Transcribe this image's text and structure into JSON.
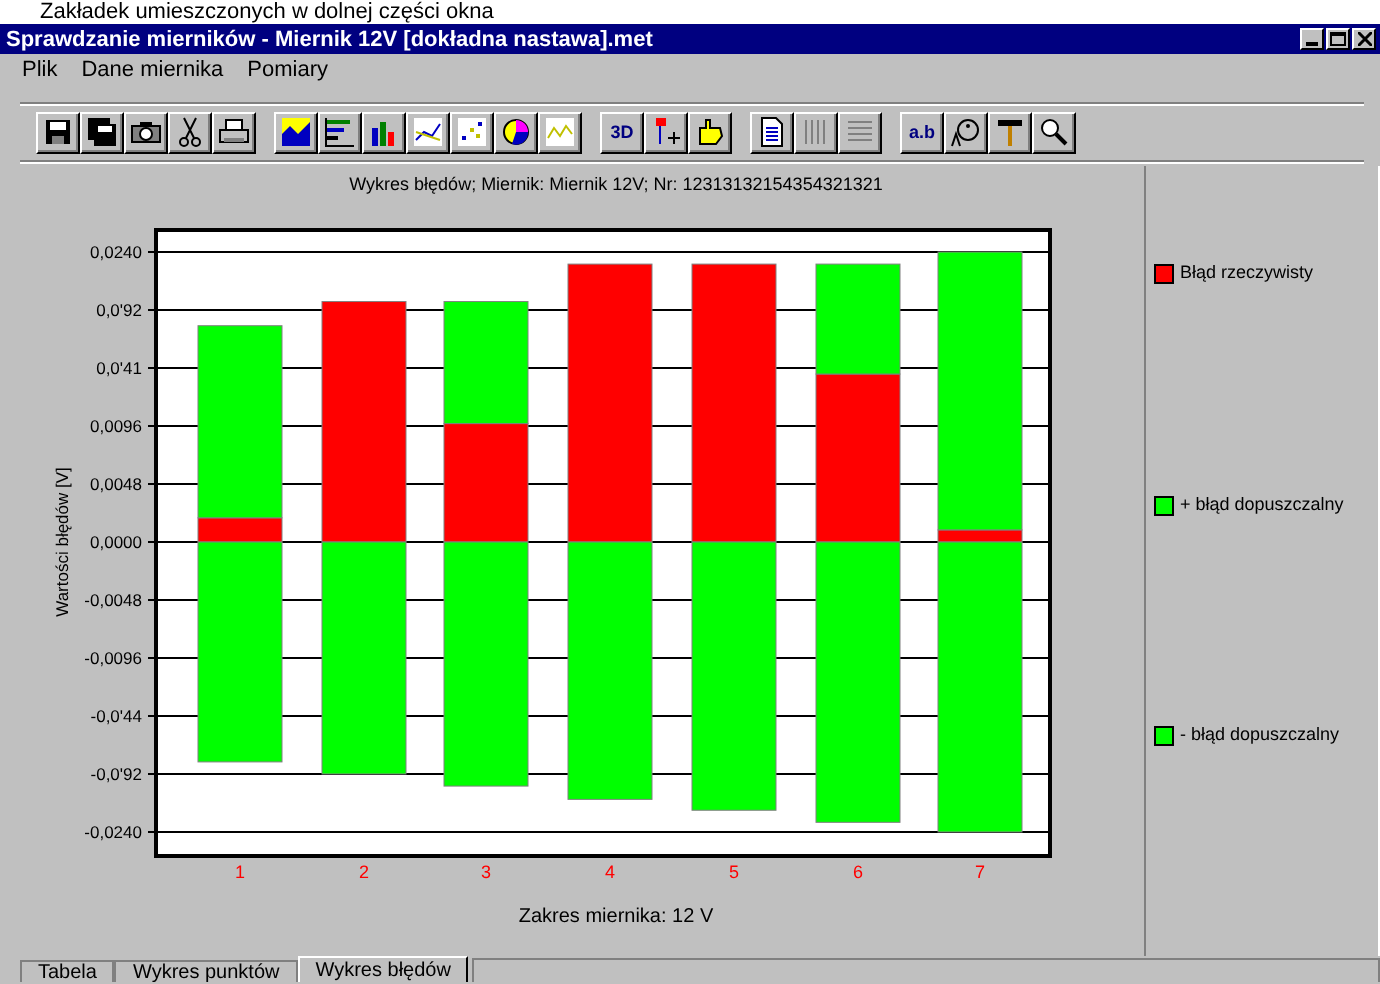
{
  "caption": "Zakładek umieszczonych w dolnej części okna",
  "window": {
    "title": "Sprawdzanie mierników - Miernik 12V [dokładna nastawa].met"
  },
  "menu": [
    "Plik",
    "Dane miernika",
    "Pomiary"
  ],
  "toolbar": [
    [
      {
        "kind": "floppy"
      },
      {
        "kind": "floppy-stack"
      },
      {
        "kind": "camera"
      },
      {
        "kind": "scissors"
      },
      {
        "kind": "printer"
      }
    ],
    [
      {
        "kind": "area"
      },
      {
        "kind": "hbar"
      },
      {
        "kind": "bar"
      },
      {
        "kind": "line"
      },
      {
        "kind": "scatter"
      },
      {
        "kind": "pie"
      },
      {
        "kind": "wave"
      }
    ],
    [
      {
        "kind": "text",
        "label": "3D"
      },
      {
        "kind": "pin"
      },
      {
        "kind": "hand"
      }
    ],
    [
      {
        "kind": "page"
      },
      {
        "kind": "columns"
      },
      {
        "kind": "rows"
      }
    ],
    [
      {
        "kind": "text",
        "label": "a.b"
      },
      {
        "kind": "font"
      },
      {
        "kind": "hammer"
      },
      {
        "kind": "zoom"
      }
    ]
  ],
  "chart": {
    "chart_data": {
      "type": "bar",
      "stacked": true,
      "title": "Wykres błędów; Miernik: Miernik 12V; Nr: 12313132154354321321",
      "xlabel": "Zakres miernika: 12 V",
      "ylabel": "Wartości błędów [V]",
      "categories": [
        "1",
        "2",
        "3",
        "4",
        "5",
        "6",
        "7"
      ],
      "series": [
        {
          "name": "Błąd rzeczywisty",
          "color": "#ff0000",
          "values": [
            0.002,
            0.0199,
            0.0098,
            0.023,
            0.023,
            0.0139,
            0.001
          ]
        },
        {
          "name": "+ błąd dopuszczalny",
          "color": "#00ff00",
          "values": [
            0.0159,
            0,
            0.0101,
            0,
            0,
            0.0091,
            0.023
          ]
        },
        {
          "name": "- błąd dopuszczalny",
          "color": "#00ff00",
          "values": [
            -0.0182,
            -0.0192,
            -0.0202,
            -0.0213,
            -0.0222,
            -0.0232,
            -0.024
          ]
        }
      ],
      "ylim": [
        -0.024,
        0.024
      ],
      "grid": true,
      "yticks": [
        {
          "value": 0.024,
          "label": "0,0240"
        },
        {
          "value": 0.0192,
          "label": "0,0'92"
        },
        {
          "value": 0.0144,
          "label": "0,0'41"
        },
        {
          "value": 0.0096,
          "label": "0,0096"
        },
        {
          "value": 0.0048,
          "label": "0,0048"
        },
        {
          "value": 0,
          "label": "0,0000"
        },
        {
          "value": -0.0048,
          "label": "-0,0048"
        },
        {
          "value": -0.0096,
          "label": "-0,0096"
        },
        {
          "value": -0.0144,
          "label": "-0,0'44"
        },
        {
          "value": -0.0192,
          "label": "-0,0'92"
        },
        {
          "value": -0.024,
          "label": "-0,0240"
        }
      ]
    }
  },
  "tabs": [
    {
      "label": "Tabela",
      "selected": false
    },
    {
      "label": "Wykres punktów",
      "selected": false
    },
    {
      "label": "Wykres błędów",
      "selected": true
    }
  ]
}
